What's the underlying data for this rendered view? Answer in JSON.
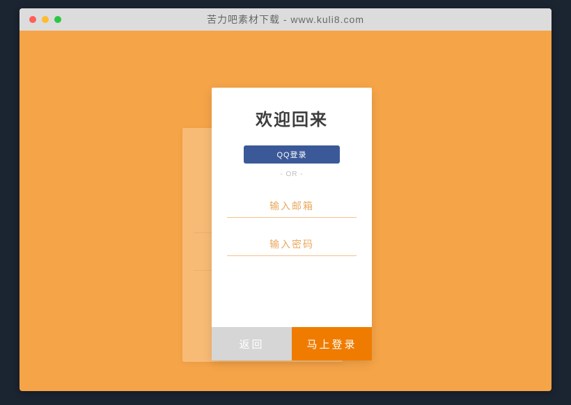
{
  "window": {
    "title": "苦力吧素材下载 - www.kuli8.com"
  },
  "card": {
    "title": "欢迎回来",
    "qq_login": "QQ登录",
    "or": "- OR -",
    "email_placeholder": "输入邮箱",
    "password_placeholder": "输入密码",
    "back": "返回",
    "login": "马上登录"
  }
}
